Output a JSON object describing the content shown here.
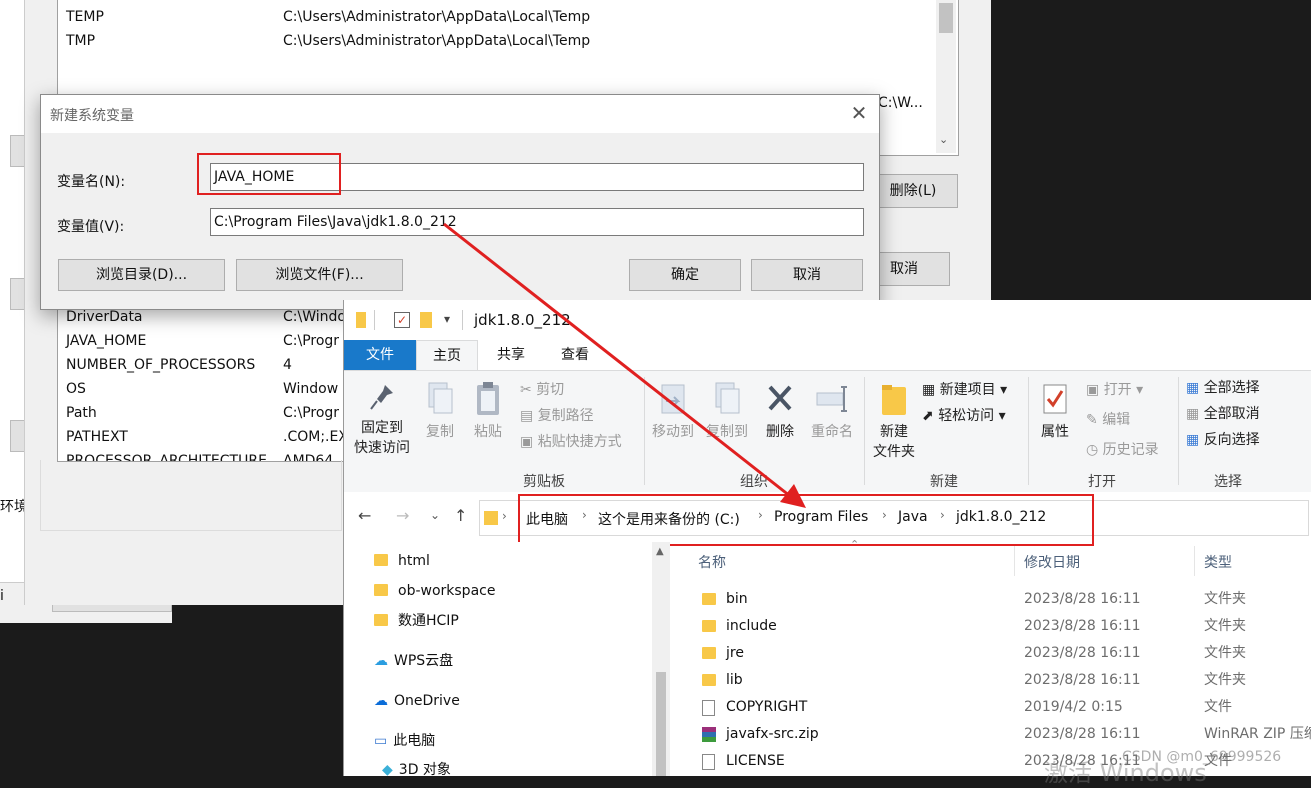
{
  "env_window": {
    "user_vars_rows": [
      {
        "name": "TEMP",
        "value": "C:\\Users\\Administrator\\AppData\\Local\\Temp"
      },
      {
        "name": "TMP",
        "value": "C:\\Users\\Administrator\\AppData\\Local\\Temp"
      }
    ],
    "system_vars_rows": [
      {
        "name": "DriverData",
        "value": "C:\\Windo"
      },
      {
        "name": "JAVA_HOME",
        "value": "C:\\Progr"
      },
      {
        "name": "NUMBER_OF_PROCESSORS",
        "value": "4"
      },
      {
        "name": "OS",
        "value": "Window"
      },
      {
        "name": "Path",
        "value": "C:\\Progr"
      },
      {
        "name": "PATHEXT",
        "value": ".COM;.EX"
      },
      {
        "name": "PROCESSOR_ARCHITECTURE",
        "value": "AMD64"
      }
    ],
    "right_partial_value": "C:\\W...",
    "delete_button": "删除(L)",
    "cancel_button": "取消",
    "left_cut_label": "环境",
    "left_cut_label2": "i"
  },
  "dialog": {
    "title": "新建系统变量",
    "name_label": "变量名(N):",
    "name_value": "JAVA_HOME",
    "value_label": "变量值(V):",
    "value_value": "C:\\Program Files\\Java\\jdk1.8.0_212",
    "browse_dir_button": "浏览目录(D)...",
    "browse_file_button": "浏览文件(F)...",
    "ok_button": "确定",
    "cancel_button": "取消"
  },
  "explorer": {
    "title": "jdk1.8.0_212",
    "tabs": [
      "文件",
      "主页",
      "共享",
      "查看"
    ],
    "ribbon": {
      "pin_label_1": "固定到",
      "pin_label_2": "快速访问",
      "copy": "复制",
      "paste": "粘贴",
      "cut": "剪切",
      "copy_path": "复制路径",
      "paste_shortcut": "粘贴快捷方式",
      "group_clipboard": "剪贴板",
      "move_to": "移动到",
      "copy_to": "复制到",
      "delete": "删除",
      "rename": "重命名",
      "group_organize": "组织",
      "new_folder_1": "新建",
      "new_folder_2": "文件夹",
      "new_item": "新建项目",
      "easy_access": "轻松访问",
      "group_new": "新建",
      "properties": "属性",
      "open": "打开",
      "edit": "编辑",
      "history": "历史记录",
      "group_open": "打开",
      "select_all": "全部选择",
      "select_none": "全部取消",
      "invert_selection": "反向选择",
      "group_select": "选择"
    },
    "breadcrumb": [
      "此电脑",
      "这个是用来备份的 (C:)",
      "Program Files",
      "Java",
      "jdk1.8.0_212"
    ],
    "nav_items": [
      {
        "label": "html",
        "icon": "folder-icon"
      },
      {
        "label": "ob-workspace",
        "icon": "folder-icon"
      },
      {
        "label": "数通HCIP",
        "icon": "folder-icon"
      },
      {
        "label": "WPS云盘",
        "icon": "cloud-icon"
      },
      {
        "label": "OneDrive",
        "icon": "onedrive-icon"
      },
      {
        "label": "此电脑",
        "icon": "pc-icon"
      },
      {
        "label": "3D 对象",
        "icon": "3d-icon"
      }
    ],
    "columns": {
      "name": "名称",
      "date": "修改日期",
      "type": "类型"
    },
    "files": [
      {
        "name": "bin",
        "date": "2023/8/28 16:11",
        "type": "文件夹",
        "icon": "folder"
      },
      {
        "name": "include",
        "date": "2023/8/28 16:11",
        "type": "文件夹",
        "icon": "folder"
      },
      {
        "name": "jre",
        "date": "2023/8/28 16:11",
        "type": "文件夹",
        "icon": "folder"
      },
      {
        "name": "lib",
        "date": "2023/8/28 16:11",
        "type": "文件夹",
        "icon": "folder"
      },
      {
        "name": "COPYRIGHT",
        "date": "2019/4/2 0:15",
        "type": "文件",
        "icon": "file"
      },
      {
        "name": "javafx-src.zip",
        "date": "2023/8/28 16:11",
        "type": "WinRAR ZIP 压缩",
        "icon": "zip"
      },
      {
        "name": "LICENSE",
        "date": "2023/8/28 16:11",
        "type": "文件",
        "icon": "file"
      }
    ],
    "watermark": "CSDN @m0_69999526",
    "activate_text": "激活 Windows"
  },
  "colors": {
    "annotation_red": "#e02020",
    "ribbon_file_tab": "#1979ca",
    "folder": "#f8c848"
  }
}
